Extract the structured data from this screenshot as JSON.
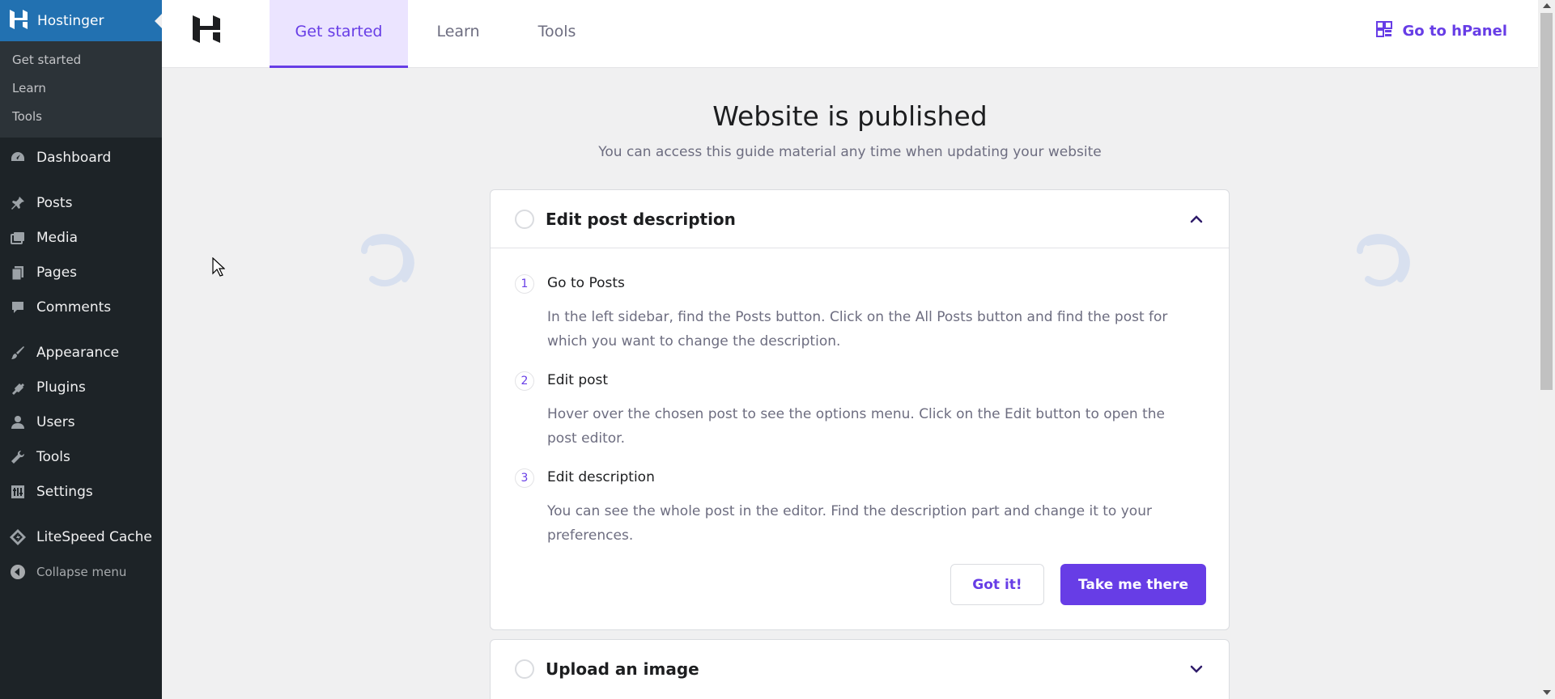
{
  "sidebar": {
    "current": "Hostinger",
    "submenu": [
      "Get started",
      "Learn",
      "Tools"
    ],
    "items": [
      {
        "label": "Dashboard",
        "icon": "dashboard-icon"
      },
      {
        "label": "Posts",
        "icon": "pin-icon"
      },
      {
        "label": "Media",
        "icon": "media-icon"
      },
      {
        "label": "Pages",
        "icon": "pages-icon"
      },
      {
        "label": "Comments",
        "icon": "comment-icon"
      },
      {
        "label": "Appearance",
        "icon": "brush-icon"
      },
      {
        "label": "Plugins",
        "icon": "plug-icon"
      },
      {
        "label": "Users",
        "icon": "user-icon"
      },
      {
        "label": "Tools",
        "icon": "wrench-icon"
      },
      {
        "label": "Settings",
        "icon": "sliders-icon"
      },
      {
        "label": "LiteSpeed Cache",
        "icon": "diamond-icon"
      }
    ],
    "collapse": "Collapse menu"
  },
  "topbar": {
    "tabs": [
      "Get started",
      "Learn",
      "Tools"
    ],
    "active_tab": "Get started",
    "hpanel_link": "Go to hPanel"
  },
  "main": {
    "headline": "Website is published",
    "subline": "You can access this guide material any time when updating your website",
    "cards": [
      {
        "title": "Edit post description",
        "expanded": true,
        "steps": [
          {
            "num": "1",
            "title": "Go to Posts",
            "desc": "In the left sidebar, find the Posts button. Click on the All Posts button and find the post for which you want to change the description."
          },
          {
            "num": "2",
            "title": "Edit post",
            "desc": "Hover over the chosen post to see the options menu. Click on the Edit button to open the post editor."
          },
          {
            "num": "3",
            "title": "Edit description",
            "desc": "You can see the whole post in the editor. Find the description part and change it to your preferences."
          }
        ],
        "secondary_button": "Got it!",
        "primary_button": "Take me there"
      },
      {
        "title": "Upload an image",
        "expanded": false
      }
    ]
  },
  "colors": {
    "accent": "#673de6",
    "sidebar_bg": "#1d2327",
    "sidebar_active": "#2271b1",
    "page_bg": "#f0f0f1"
  }
}
